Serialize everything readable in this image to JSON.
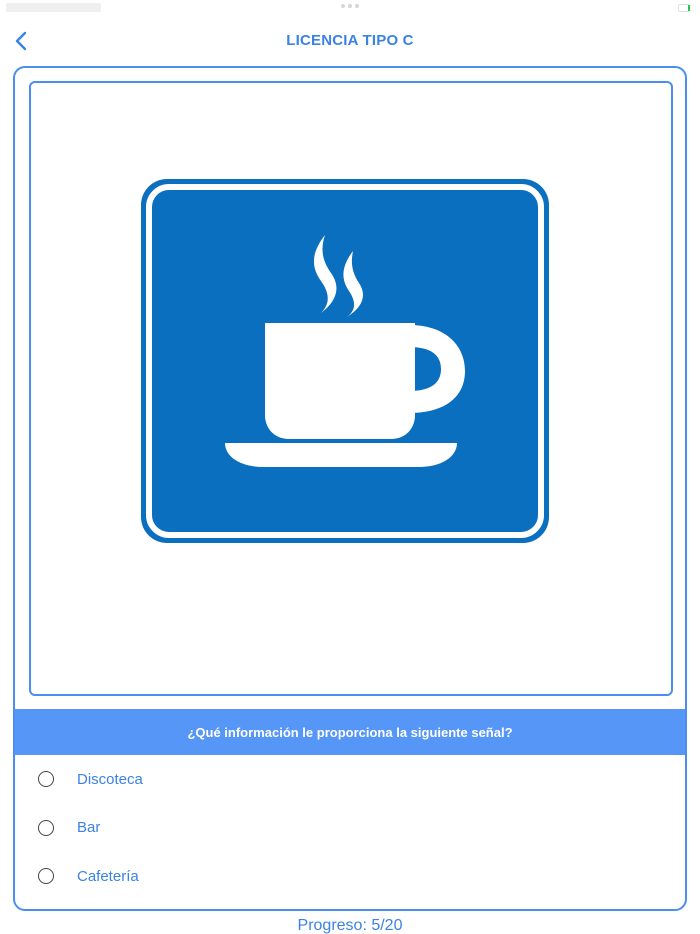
{
  "nav": {
    "title": "LICENCIA TIPO C"
  },
  "question": {
    "text": "¿Qué información le proporciona la siguiente señal?",
    "sign_icon": "coffee-cup-icon",
    "sign_color": "#0b6fbf"
  },
  "options": [
    {
      "label": "Discoteca"
    },
    {
      "label": "Bar"
    },
    {
      "label": "Cafetería"
    }
  ],
  "progress": {
    "label": "Progreso: 5/20",
    "current": 5,
    "total": 20
  },
  "colors": {
    "accent": "#3b82e6",
    "banner": "#5696f7",
    "border": "#4a8ef0"
  }
}
